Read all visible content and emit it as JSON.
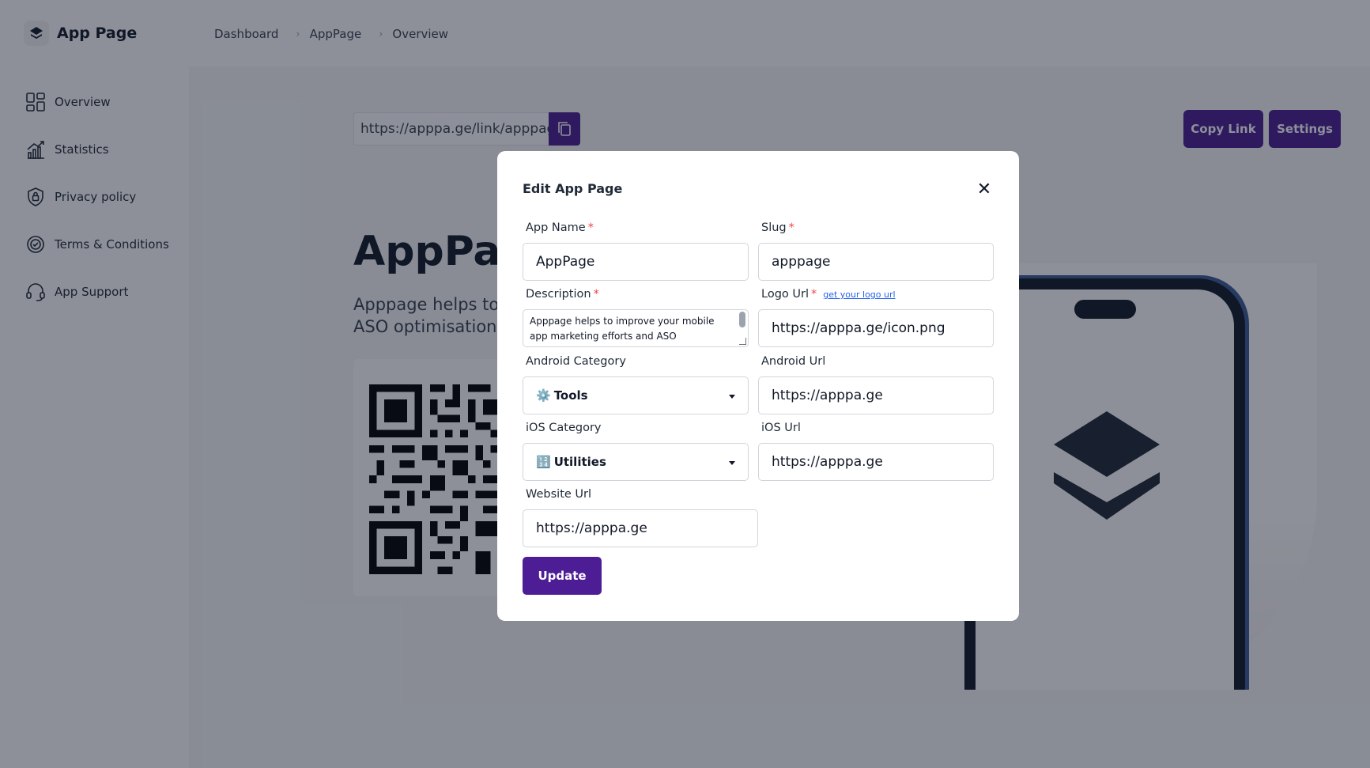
{
  "app": {
    "name": "App Page"
  },
  "breadcrumb": [
    "Dashboard",
    "AppPage",
    "Overview"
  ],
  "sidebar": {
    "items": [
      {
        "label": "Overview",
        "icon": "grid-icon"
      },
      {
        "label": "Statistics",
        "icon": "chart-icon"
      },
      {
        "label": "Privacy policy",
        "icon": "shield-icon"
      },
      {
        "label": "Terms & Conditions",
        "icon": "badge-icon"
      },
      {
        "label": "App Support",
        "icon": "headset-icon"
      }
    ]
  },
  "page": {
    "share_link": "https://apppa.ge/link/apppage",
    "copy_link_label": "Copy Link",
    "settings_label": "Settings",
    "title": "AppPage",
    "description": "Apppage helps to improve your mobile app marketing efforts and ASO optimisation for"
  },
  "modal": {
    "title": "Edit App Page",
    "fields": {
      "app_name": {
        "label": "App Name",
        "value": "AppPage"
      },
      "slug": {
        "label": "Slug",
        "value": "apppage"
      },
      "description": {
        "label": "Description",
        "value": "Apppage helps to improve your mobile app marketing efforts and ASO optimisation for"
      },
      "logo_url": {
        "label": "Logo Url",
        "link": "get your logo url",
        "value": "https://apppa.ge/icon.png"
      },
      "android_category": {
        "label": "Android Category",
        "value": "Tools",
        "emoji": "⚙️"
      },
      "android_url": {
        "label": "Android Url",
        "value": "https://apppa.ge"
      },
      "ios_category": {
        "label": "iOS Category",
        "value": "Utilities",
        "emoji": "🔢"
      },
      "ios_url": {
        "label": "iOS Url",
        "value": "https://apppa.ge"
      },
      "website_url": {
        "label": "Website Url",
        "value": "https://apppa.ge"
      }
    },
    "update_label": "Update"
  },
  "colors": {
    "accent": "#4c1d95",
    "required": "#ef4444",
    "overlay": "rgba(17,24,39,0.48)"
  }
}
